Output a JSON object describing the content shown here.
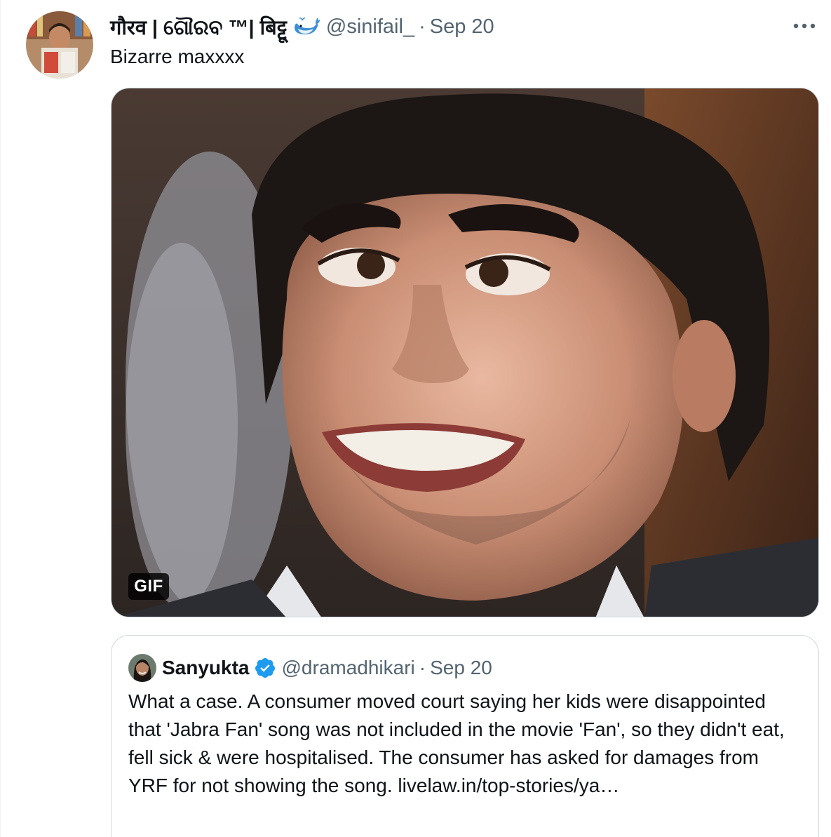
{
  "tweet": {
    "display_name": "गौरव | ଗୌରବ ™| बिट्टू",
    "handle": "@sinifail_",
    "separator": "·",
    "time": "Sep 20",
    "text": "Bizarre maxxxx",
    "badge_icon": "whale-emoji-icon",
    "more_icon": "more-options-icon"
  },
  "media": {
    "badge": "GIF",
    "type": "gif"
  },
  "quote": {
    "display_name": "Sanyukta",
    "verified_icon": "verified-badge-icon",
    "handle": "@dramadhikari",
    "separator": "·",
    "time": "Sep 20",
    "text": "What a case. A consumer moved court saying her kids were disappointed that 'Jabra Fan' song was not included in the movie 'Fan', so they didn't eat, fell sick & were hospitalised. The consumer has asked for damages from YRF for not showing the song.  livelaw.in/top-stories/ya…"
  },
  "colors": {
    "text_primary": "#0f1419",
    "text_secondary": "#536471",
    "border": "#cfd9de",
    "verified": "#1d9bf0"
  }
}
